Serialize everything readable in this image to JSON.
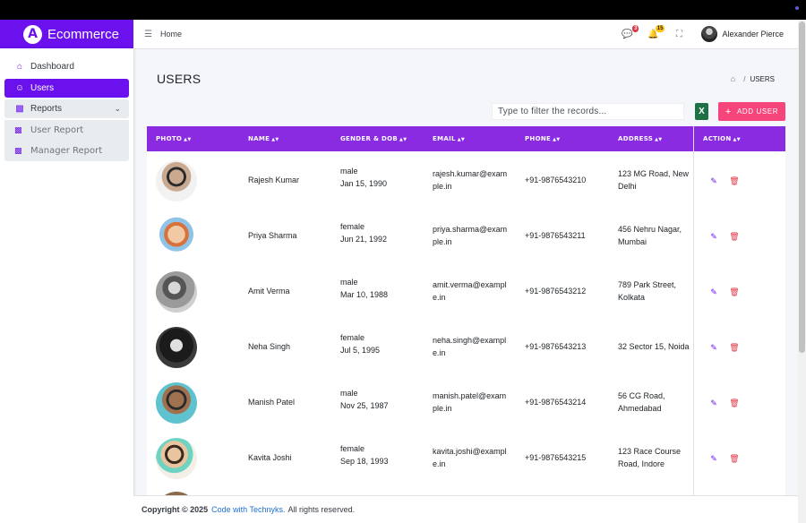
{
  "brand": {
    "logo_letter": "A",
    "name": "Ecommerce",
    "color": "#6a11ee"
  },
  "header": {
    "home": "Home",
    "messages_count": "3",
    "notifications_count": "15",
    "user_name": "Alexander Pierce"
  },
  "sidebar": {
    "dashboard": "Dashboard",
    "users": "Users",
    "reports": "Reports",
    "user_report": "User Report",
    "manager_report": "Manager Report"
  },
  "page": {
    "title": "USERS",
    "breadcrumb_current": "USERS",
    "filter_placeholder": "Type to filter the records...",
    "excel_label": "X",
    "add_user": "ADD USER"
  },
  "table": {
    "headers": {
      "photo": "PHOTO",
      "name": "NAME",
      "gender_dob": "GENDER & DOB",
      "email": "EMAIL",
      "phone": "PHONE",
      "address": "ADDRESS",
      "action": "ACTION"
    },
    "rows": [
      {
        "name": "Rajesh Kumar",
        "gender": "male",
        "dob": "Jan 15, 1990",
        "email1": "rajesh.kumar@exam",
        "email2": "ple.in",
        "phone": "+91-9876543210",
        "addr1": "123 MG Road, New",
        "addr2": "Delhi"
      },
      {
        "name": "Priya Sharma",
        "gender": "female",
        "dob": "Jun 21, 1992",
        "email1": "priya.sharma@exam",
        "email2": "ple.in",
        "phone": "+91-9876543211",
        "addr1": "456 Nehru Nagar,",
        "addr2": "Mumbai"
      },
      {
        "name": "Amit Verma",
        "gender": "male",
        "dob": "Mar 10, 1988",
        "email1": "amit.verma@exampl",
        "email2": "e.in",
        "phone": "+91-9876543212",
        "addr1": "789 Park Street,",
        "addr2": "Kolkata"
      },
      {
        "name": "Neha Singh",
        "gender": "female",
        "dob": "Jul 5, 1995",
        "email1": "neha.singh@exampl",
        "email2": "e.in",
        "phone": "+91-9876543213",
        "addr1": "32 Sector 15, Noida",
        "addr2": ""
      },
      {
        "name": "Manish Patel",
        "gender": "male",
        "dob": "Nov 25, 1987",
        "email1": "manish.patel@exam",
        "email2": "ple.in",
        "phone": "+91-9876543214",
        "addr1": "56 CG Road,",
        "addr2": "Ahmedabad"
      },
      {
        "name": "Kavita Joshi",
        "gender": "female",
        "dob": "Sep 18, 1993",
        "email1": "kavita.joshi@exampl",
        "email2": "e.in",
        "phone": "+91-9876543215",
        "addr1": "123 Race Course",
        "addr2": "Road, Indore"
      }
    ]
  },
  "footer": {
    "copyright": "Copyright © 2025",
    "link": "Code with Technyks.",
    "rights": "All rights reserved."
  }
}
